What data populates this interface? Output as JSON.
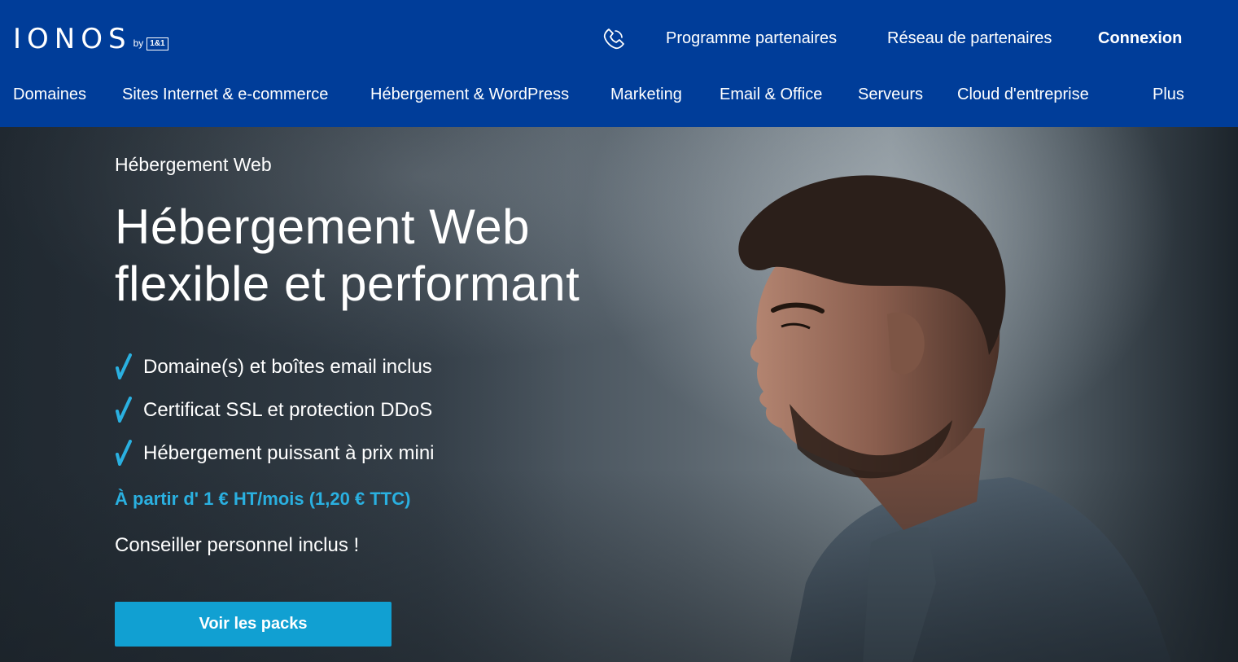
{
  "header": {
    "logo": {
      "word": "IONOS",
      "by": "by",
      "box": "1&1"
    },
    "phone_icon": "phone-icon",
    "top_links": [
      "Programme partenaires",
      "Réseau de partenaires",
      "Connexion"
    ],
    "nav": [
      "Domaines",
      "Sites Internet & e-commerce",
      "Hébergement & WordPress",
      "Marketing",
      "Email & Office",
      "Serveurs",
      "Cloud d'entreprise",
      "Plus"
    ]
  },
  "hero": {
    "eyebrow": "Hébergement Web",
    "headline_line1": "Hébergement Web",
    "headline_line2": "flexible et performant",
    "features": [
      "Domaine(s) et boîtes email inclus",
      "Certificat SSL et protection DDoS",
      "Hébergement puissant à prix mini"
    ],
    "price": "À partir d' 1 € HT/mois (1,20 € TTC)",
    "advisor": "Conseiller personnel inclus !",
    "cta": "Voir les packs"
  },
  "colors": {
    "header_bg": "#003d99",
    "accent": "#11a0d2",
    "price_text": "#2ab0e0",
    "check": "#2ab0e0"
  }
}
